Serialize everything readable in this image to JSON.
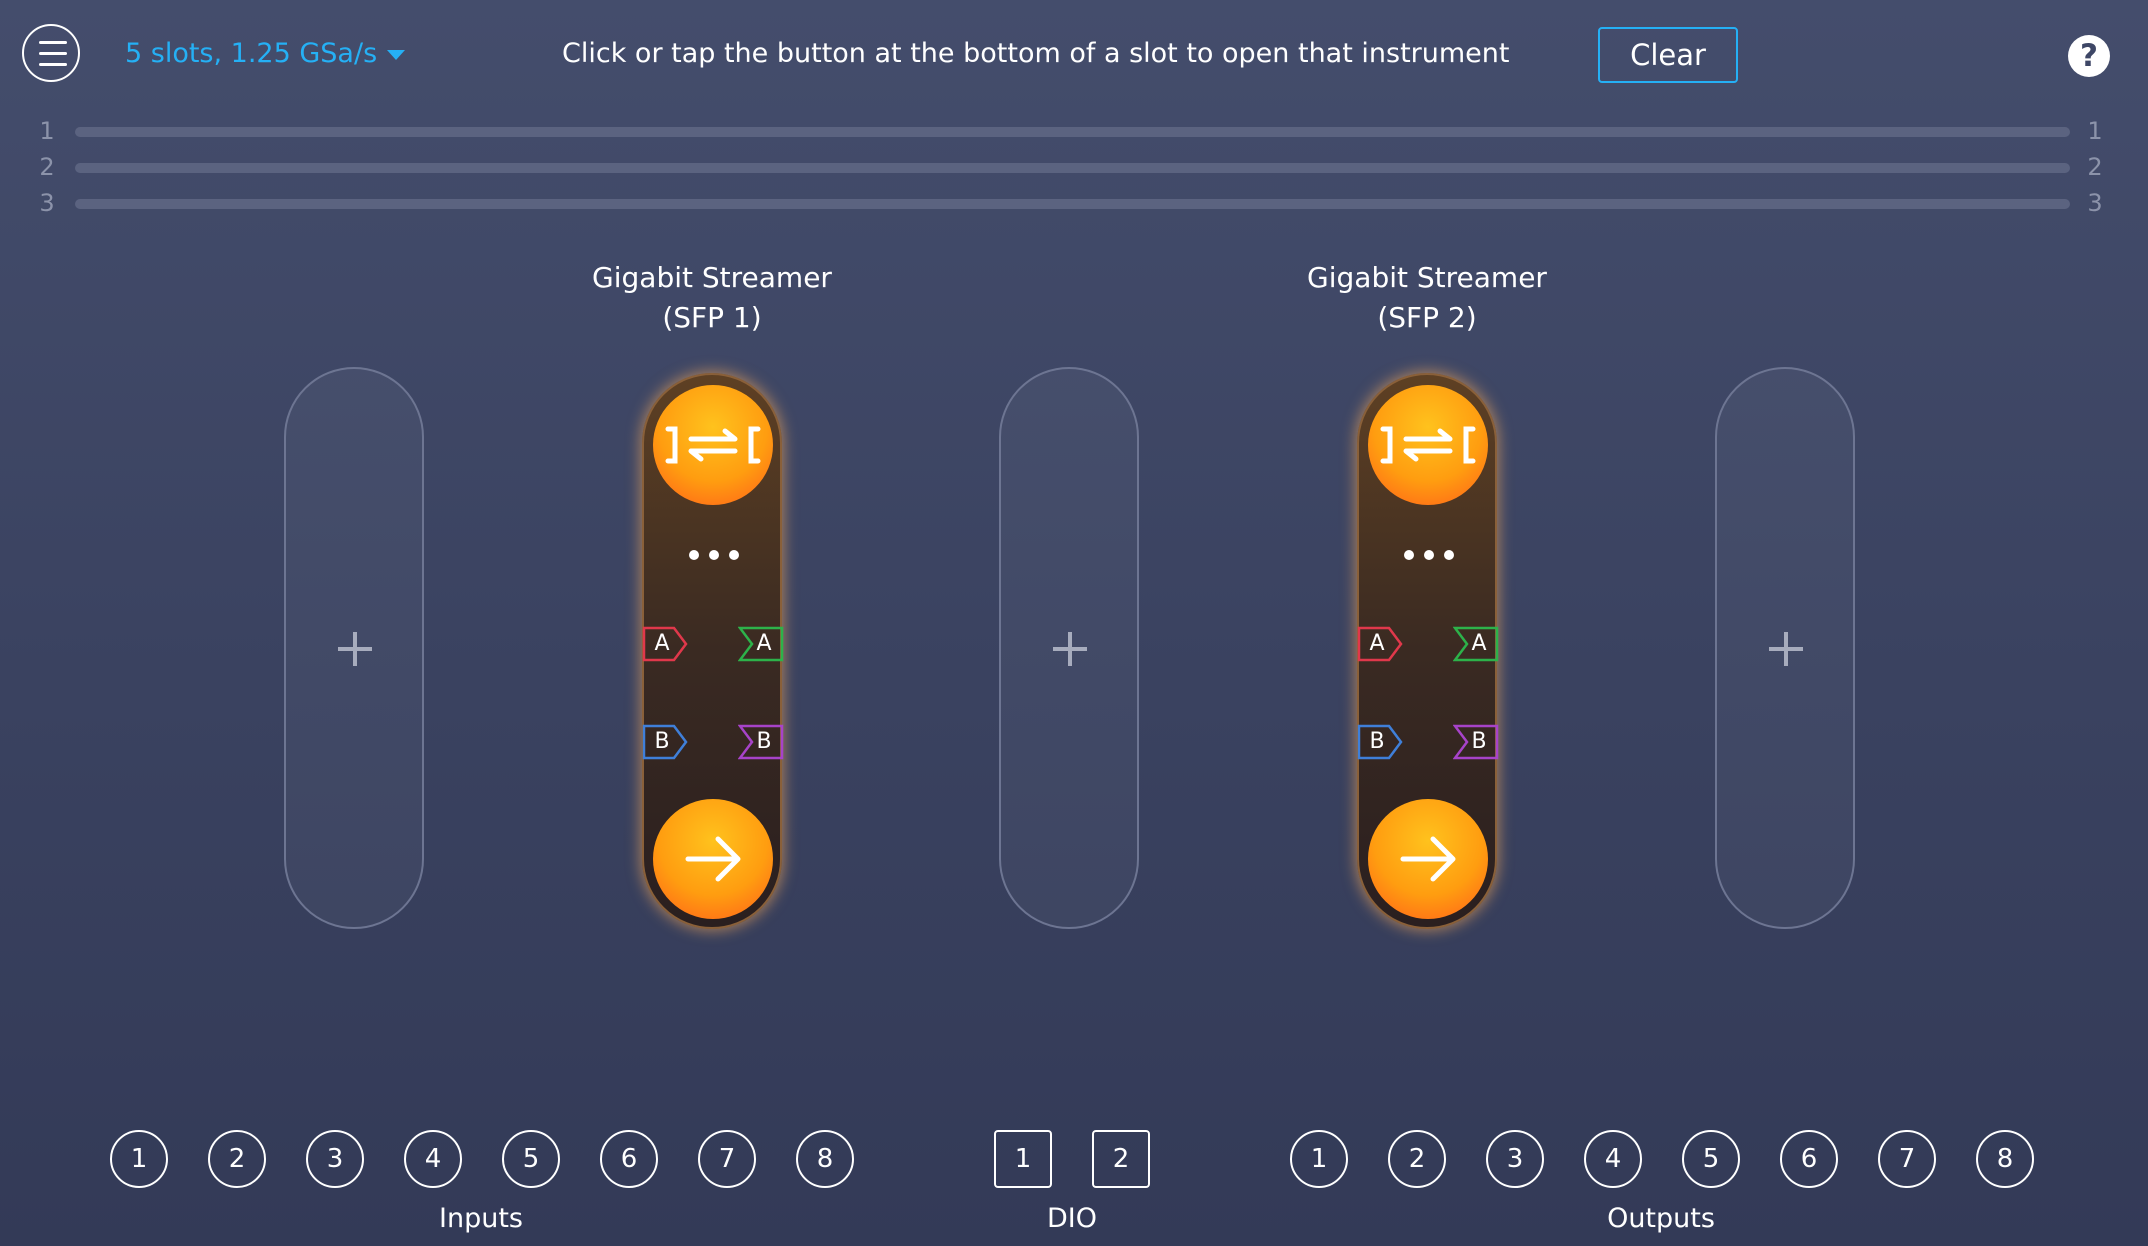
{
  "toolbar": {
    "config_label": "5 slots, 1.25 GSa/s",
    "hint": "Click or tap the button at the bottom of a slot to open that instrument",
    "clear_label": "Clear",
    "help_label": "?"
  },
  "channels": {
    "left": [
      "1",
      "2",
      "3"
    ],
    "right": [
      "1",
      "2",
      "3"
    ]
  },
  "slots": [
    {
      "state": "empty",
      "plus": "+"
    },
    {
      "state": "instrument",
      "title_line1": "Gigabit Streamer",
      "title_line2": "(SFP 1)",
      "icon": "streamer-icon",
      "ports": {
        "in_a": "A",
        "out_a": "A",
        "in_b": "B",
        "out_b": "B"
      }
    },
    {
      "state": "empty",
      "plus": "+"
    },
    {
      "state": "instrument",
      "title_line1": "Gigabit Streamer",
      "title_line2": "(SFP 2)",
      "icon": "streamer-icon",
      "ports": {
        "in_a": "A",
        "out_a": "A",
        "in_b": "B",
        "out_b": "B"
      }
    },
    {
      "state": "empty",
      "plus": "+"
    }
  ],
  "io": {
    "inputs": [
      "1",
      "2",
      "3",
      "4",
      "5",
      "6",
      "7",
      "8"
    ],
    "inputs_label": "Inputs",
    "dio": [
      "1",
      "2"
    ],
    "dio_label": "DIO",
    "outputs": [
      "1",
      "2",
      "3",
      "4",
      "5",
      "6",
      "7",
      "8"
    ],
    "outputs_label": "Outputs"
  },
  "colors": {
    "accent": "#25b0f5",
    "port_in_a": "#e0384b",
    "port_out_a": "#2db24a",
    "port_in_b": "#3f7fd9",
    "port_out_b": "#a743c9",
    "orb": "#ff9d10"
  }
}
